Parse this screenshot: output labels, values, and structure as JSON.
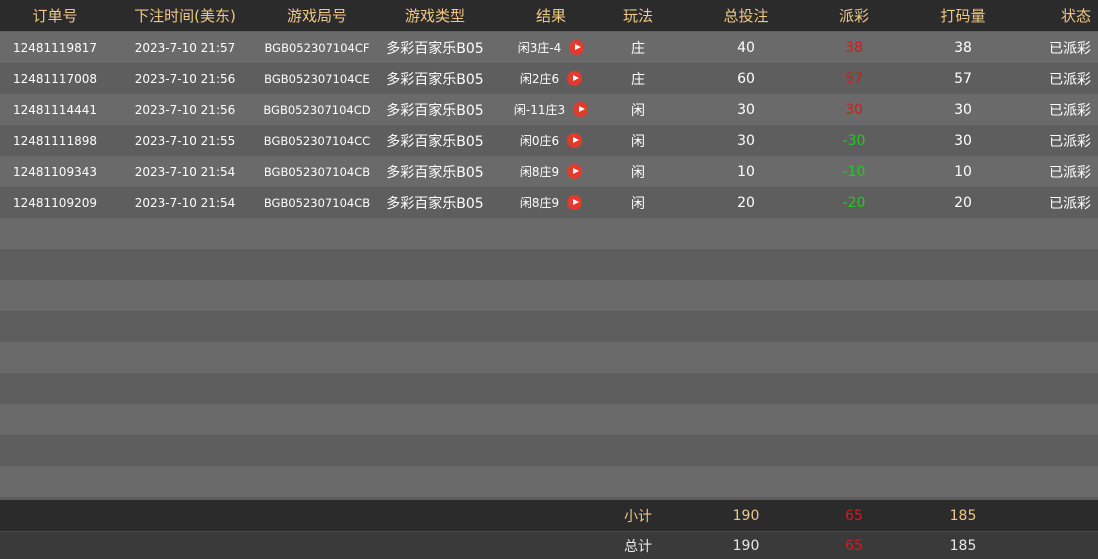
{
  "header": {
    "order_no": "订单号",
    "bet_time": "下注时间(美东)",
    "round_no": "游戏局号",
    "game_type": "游戏类型",
    "result": "结果",
    "play": "玩法",
    "total_bet": "总投注",
    "payout": "派彩",
    "turnover": "打码量",
    "status": "状态"
  },
  "rows": [
    {
      "order_no": "12481119817",
      "bet_time": "2023-7-10 21:57",
      "round_no": "BGB052307104CF",
      "game_type": "多彩百家乐B05",
      "result": "闲3庄-4",
      "play": "庄",
      "total_bet": "40",
      "payout": "38",
      "payout_color": "#d21c1c",
      "turnover": "38",
      "status": "已派彩"
    },
    {
      "order_no": "12481117008",
      "bet_time": "2023-7-10 21:56",
      "round_no": "BGB052307104CE",
      "game_type": "多彩百家乐B05",
      "result": "闲2庄6",
      "play": "庄",
      "total_bet": "60",
      "payout": "57",
      "payout_color": "#d21c1c",
      "turnover": "57",
      "status": "已派彩"
    },
    {
      "order_no": "12481114441",
      "bet_time": "2023-7-10 21:56",
      "round_no": "BGB052307104CD",
      "game_type": "多彩百家乐B05",
      "result": "闲-11庄3",
      "play": "闲",
      "total_bet": "30",
      "payout": "30",
      "payout_color": "#d21c1c",
      "turnover": "30",
      "status": "已派彩"
    },
    {
      "order_no": "12481111898",
      "bet_time": "2023-7-10 21:55",
      "round_no": "BGB052307104CC",
      "game_type": "多彩百家乐B05",
      "result": "闲0庄6",
      "play": "闲",
      "total_bet": "30",
      "payout": "-30",
      "payout_color": "#22c91f",
      "turnover": "30",
      "status": "已派彩"
    },
    {
      "order_no": "12481109343",
      "bet_time": "2023-7-10 21:54",
      "round_no": "BGB052307104CB",
      "game_type": "多彩百家乐B05",
      "result": "闲8庄9",
      "play": "闲",
      "total_bet": "10",
      "payout": "-10",
      "payout_color": "#22c91f",
      "turnover": "10",
      "status": "已派彩"
    },
    {
      "order_no": "12481109209",
      "bet_time": "2023-7-10 21:54",
      "round_no": "BGB052307104CB",
      "game_type": "多彩百家乐B05",
      "result": "闲8庄9",
      "play": "闲",
      "total_bet": "20",
      "payout": "-20",
      "payout_color": "#22c91f",
      "turnover": "20",
      "status": "已派彩"
    }
  ],
  "subtotal": {
    "label": "小计",
    "total_bet": "190",
    "payout": "65",
    "turnover": "185"
  },
  "total": {
    "label": "总计",
    "total_bet": "190",
    "payout": "65",
    "turnover": "185"
  },
  "icons": {
    "replay": "play-icon"
  },
  "colors": {
    "header_text": "#f0c886",
    "payout_win": "#d21c1c",
    "payout_loss": "#22c91f",
    "replay_button": "#e33a2e"
  }
}
